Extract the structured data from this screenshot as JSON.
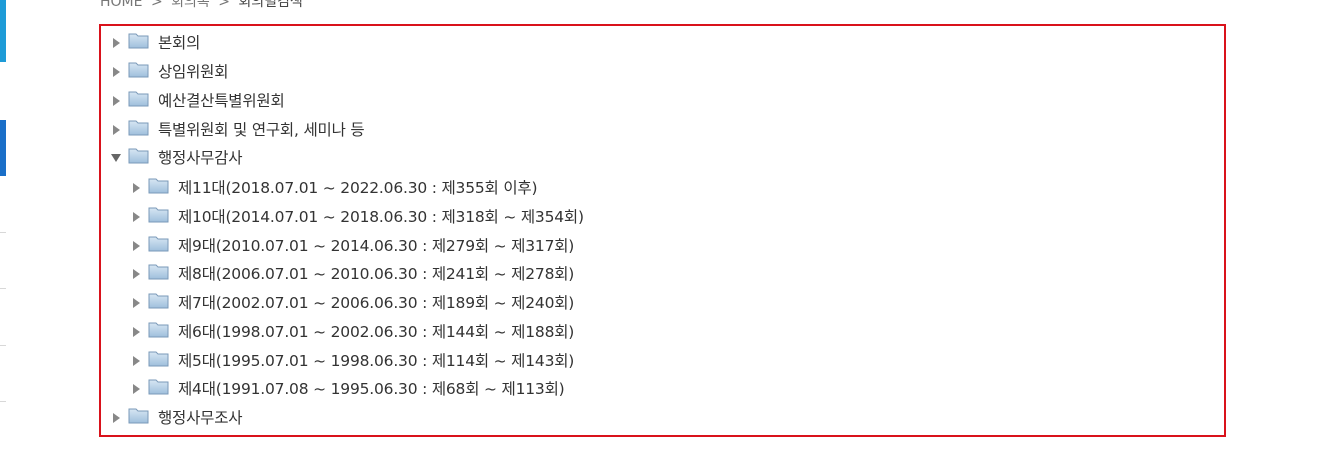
{
  "breadcrumb": {
    "home": "HOME",
    "sep1": ">",
    "level1": "회의록",
    "sep2": ">",
    "current": "회의별검색"
  },
  "tree": {
    "top_items": [
      {
        "label": "본회의",
        "expanded": false,
        "icon": "folder-icon"
      },
      {
        "label": "상임위원회",
        "expanded": false,
        "icon": "folder-icon"
      },
      {
        "label": "예산결산특별위원회",
        "expanded": false,
        "icon": "folder-icon"
      },
      {
        "label": "특별위원회 및 연구회, 세미나 등",
        "expanded": false,
        "icon": "folder-icon"
      },
      {
        "label": "행정사무감사",
        "expanded": true,
        "icon": "folder-icon"
      },
      {
        "label": "행정사무조사",
        "expanded": false,
        "icon": "folder-icon"
      }
    ],
    "children": [
      {
        "label": "제11대(2018.07.01 ~ 2022.06.30 : 제355회 이후)"
      },
      {
        "label": "제10대(2014.07.01 ~ 2018.06.30 : 제318회 ~ 제354회)"
      },
      {
        "label": "제9대(2010.07.01 ~ 2014.06.30 : 제279회 ~ 제317회)"
      },
      {
        "label": "제8대(2006.07.01 ~ 2010.06.30 : 제241회 ~ 제278회)"
      },
      {
        "label": "제7대(2002.07.01 ~ 2006.06.30 : 제189회 ~ 제240회)"
      },
      {
        "label": "제6대(1998.07.01 ~ 2002.06.30 : 제144회 ~ 제188회)"
      },
      {
        "label": "제5대(1995.07.01 ~ 1998.06.30 : 제114회 ~ 제143회)"
      },
      {
        "label": "제4대(1991.07.08 ~ 1995.06.30 : 제68회 ~ 제113회)"
      }
    ]
  },
  "colors": {
    "tree_border": "#d9121b",
    "side_accent_top": "#1e9bd7",
    "side_accent_mid": "#1a6fc8"
  }
}
